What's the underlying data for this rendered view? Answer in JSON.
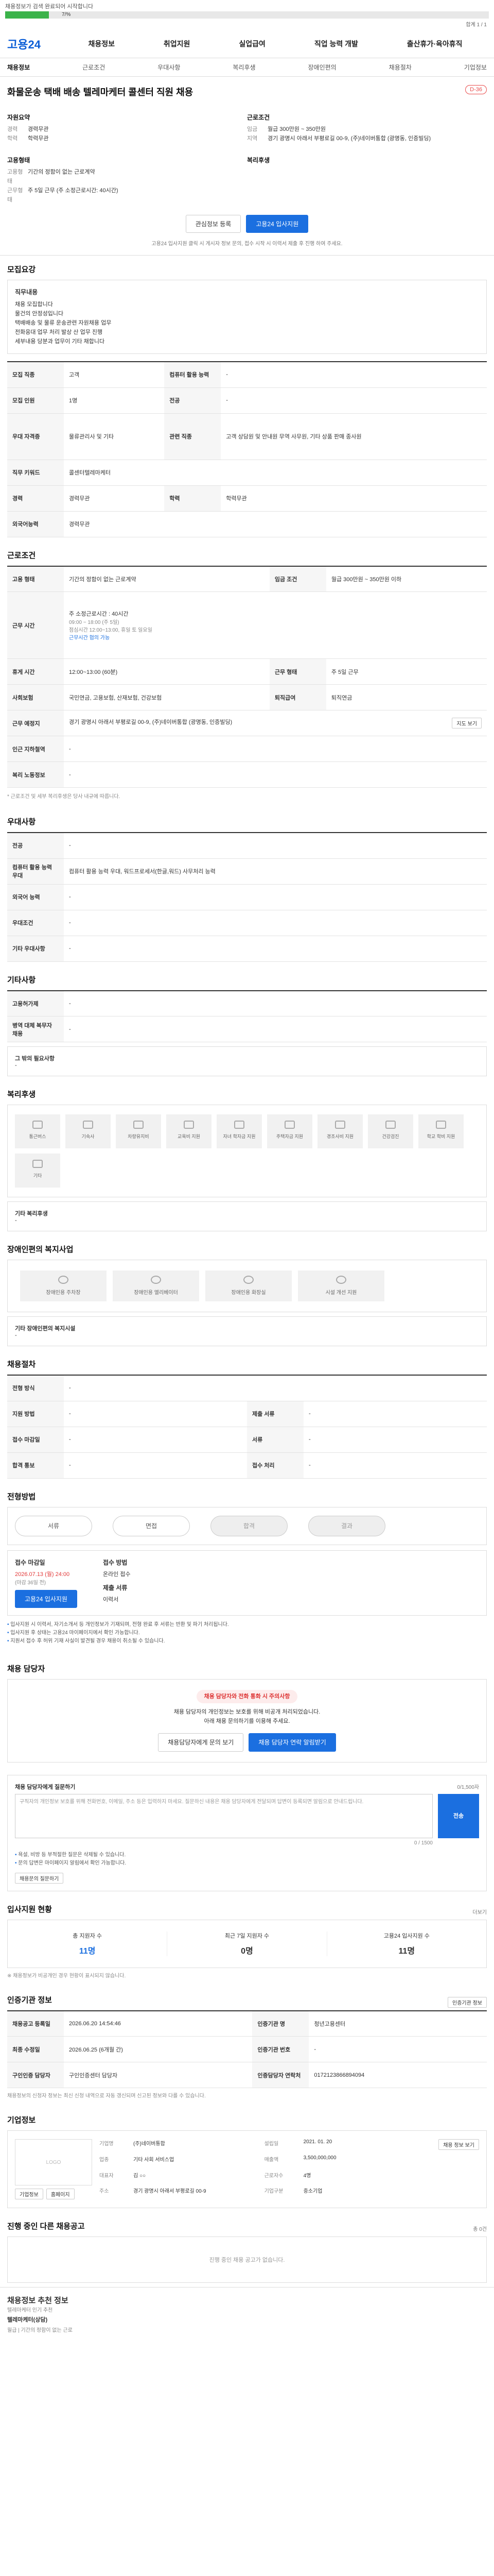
{
  "top": {
    "status": "채용정보가 검색 완료되어 시작합니다",
    "progress_label": "7/%",
    "progress": 0.09,
    "meta": "합계 1 / 1"
  },
  "header": {
    "logo": "고용24",
    "nav": [
      "채용정보",
      "취업지원",
      "실업급여",
      "직업 능력 개발",
      "출산휴가·육아휴직"
    ]
  },
  "subnav": [
    "채용정보",
    "근로조건",
    "우대사항",
    "복리후생",
    "장애인편의",
    "채용절차",
    "기업정보"
  ],
  "job": {
    "title": "화물운송 택배 배송 텔레마케터 콜센터 직원 채용",
    "dday": "D-36",
    "col1_h": "자원요약",
    "r1": [
      "경력",
      "경력무관"
    ],
    "r2": [
      "학력",
      "학력무관"
    ],
    "col2_h": "근로조건",
    "r3": [
      "임금",
      "월급 300만원 ~ 350만원"
    ],
    "r4": [
      "지역",
      "경기 광명시 아래서 부평로길 00-9, (주)네이버통합 (광명동, 인증빌딩)"
    ],
    "col3_h": "고용형태",
    "r5": [
      "고용형태",
      "기간의 정함이 없는 근로계약"
    ],
    "r6": [
      "근무형태",
      "주 5일 근무 (주 소정근로시간: 40시간)"
    ],
    "col4_h": "복리후생",
    "btn_save": "관심정보 등록",
    "btn_apply": "고용24 입사지원",
    "notice": "고용24 입사지원 클릭 시 게시자 정보 문의, 접수 시작 시 이력서 제출 후 진행 하여 주세요."
  },
  "sec_pref": {
    "title": "모집요강",
    "box_h": "직무내용",
    "box_lines": [
      "채용 모집합니다",
      "물건의 안정성입니다",
      "택배배송 및 물류 운송관련 자원채용 업무",
      "전화응대 업무 처리 발상 산 업무 진행",
      "세부내용 당분과 업무이 기타 채합니다"
    ],
    "rows": [
      [
        "모집 직종",
        "고객",
        "컴퓨터 활용 능력",
        "-"
      ],
      [
        "모집 인원",
        "1명",
        "전공",
        "-"
      ],
      [
        "우대 자격증",
        "물류관리사 및 기타",
        "관련 직종",
        "고객 상담원 및 안내원 무역 사무원, 기타 상품 판매 종사원"
      ],
      [
        "직무 키워드",
        "콜센터텔레마케터",
        "",
        ""
      ],
      [
        "경력",
        "경력무관",
        "학력",
        "학력무관"
      ],
      [
        "외국어능력",
        "경력무관",
        "",
        ""
      ]
    ]
  },
  "sec_cond": {
    "title": "근로조건",
    "rows": [
      [
        "고용 형태",
        "기간의 정함이 없는 근로계약",
        "임금 조건",
        "월급 300만원 ~ 350만원 이하"
      ],
      [
        "근무 시간",
        "주 소정근로시간 : 40시간",
        "",
        ""
      ],
      [
        "휴게 시간",
        "12:00~13:00 (60분)",
        "근무 형태",
        "주 5일 근무"
      ],
      [
        "사회보험",
        "국민연금, 고용보험, 산재보험, 건강보험",
        "퇴직급여",
        "퇴직연금"
      ],
      [
        "근무 예정지",
        "경기 광명시 아래서 부평로길 00-9, (주)네이버통합 (광명동, 인증빌딩)",
        "",
        ""
      ],
      [
        "인근 지하철역",
        "-",
        "",
        ""
      ],
      [
        "복리 노동정보",
        "-",
        "",
        ""
      ]
    ],
    "hours": [
      "09:00 ~ 18:00 (주 5일)",
      "점심시간 12:00~13:00, 휴일 토 일요일",
      "근무시간 협의 가능"
    ],
    "map_btn": "지도 보기",
    "note": "* 근로조건 및 세부 복리후생은 당사 내규에 따릅니다."
  },
  "sec_adv": {
    "title": "우대사항",
    "rows": [
      [
        "전공",
        "-"
      ],
      [
        "컴퓨터 활용 능력 우대",
        "컴퓨터 활용 능력 우대, 워드프로세서(한글,워드) 사무처리 능력"
      ],
      [
        "외국어 능력",
        "-"
      ],
      [
        "우대조건",
        "-"
      ],
      [
        "기타 우대사항",
        "-"
      ]
    ]
  },
  "sec_etc": {
    "title": "기타사항",
    "rows": [
      [
        "고용허가제",
        "-"
      ],
      [
        "병역 대체 복무자 채용",
        "-"
      ]
    ],
    "box": [
      "그 밖의 필요사항",
      "-"
    ]
  },
  "sec_welfare": {
    "title": "복리후생",
    "items": [
      "통근버스",
      "기숙사",
      "차량유지비",
      "교육비 지원",
      "자녀 학자금 지원",
      "주택자금 지원",
      "경조사비 지원",
      "건강검진",
      "학교 학비 지원",
      "기타"
    ],
    "list_h": "기타 복리후생",
    "list_v": "-"
  },
  "sec_disab": {
    "title": "장애인편의 복지사업",
    "items": [
      "장애인용 주차장",
      "장애인용 엘리베이터",
      "장애인용 화장실",
      "시설 개선 지원"
    ],
    "list_h": "기타 장애인편의 복지시설",
    "list_v": "-"
  },
  "sec_proc_info": {
    "title": "채용절차",
    "rows": [
      [
        "전형 방식",
        "-",
        "",
        ""
      ],
      [
        "지원 방법",
        "-",
        "제출 서류",
        "-"
      ],
      [
        "접수 마감일",
        "-",
        "서류",
        "-"
      ],
      [
        "합격 통보",
        "-",
        "접수 처리",
        "-"
      ]
    ]
  },
  "sec_proc": {
    "title": "전형방법",
    "steps": [
      "서류",
      "면접",
      "합격",
      "결과"
    ],
    "recv_h1": "접수 마감일",
    "recv_d1": "2026.07.13 (월) 24:00",
    "recv_sub1": "(마감 36일 전)",
    "recv_h2": "접수 방법",
    "recv_d2": "온라인 접수",
    "recv_h3": "제출 서류",
    "recv_d3": "이력서",
    "apply": "고용24 입사지원",
    "bullets": [
      "입사지원 시 이력서, 자기소개서 등 개인정보가 기재되며, 전형 완료 후 서류는 반환 및 파기 처리됩니다.",
      "입사지원 후 상태는 고용24 마이페이지에서 확인 가능합니다.",
      "지원서 접수 후 허위 기재 사실이 발견될 경우 채용이 취소될 수 있습니다."
    ]
  },
  "sec_contact": {
    "title": "채용 담당자",
    "pill": "채용 담당자와 전화 통화 시 주의사항",
    "lines": [
      "채용 담당자의 개인정보는 보호를 위해 비공개 처리되었습니다.",
      "아래 채용 문의하기를 이용해 주세요."
    ],
    "btn1": "채용담당자에게 문의 보기",
    "btn2": "채용 담당자 연락 알림받기"
  },
  "sec_qna": {
    "title": "채용 담당자에게 질문하기",
    "right": "0/1,500자",
    "placeholder": "구직자의 개인정보 보호를 위해 전화번호, 이메일, 주소 등은 입력하지 마세요. 질문하신 내용은 채용 담당자에게 전달되며 답변이 등록되면 알림으로 안내드립니다.",
    "send": "전송",
    "counter": "0 / 1500",
    "notes": [
      "욕설, 비방 등 부적절한 질문은 삭제될 수 있습니다.",
      "문의 답변은 마이페이지 알림에서 확인 가능합니다."
    ],
    "btn": "채용문의 질문하기"
  },
  "sec_stats": {
    "title": "입사지원 현황",
    "right": "더보기 ",
    "items": [
      [
        "총 지원자 수",
        "11명"
      ],
      [
        "최근 7일 지원자 수",
        "0명"
      ],
      [
        "고용24 입사지원 수",
        "11명"
      ]
    ],
    "note": "※ 채용정보가 비공개인 경우 현황이 표시되지 않습니다."
  },
  "sec_info": {
    "title": "인증기관 정보",
    "right": "인증기관 정보",
    "rows": [
      [
        "채용공고 등록일",
        "2026.06.20 14:54:46",
        "인증기관 명",
        "청년고용센터"
      ],
      [
        "최종 수정일",
        "2026.06.25 (6개월 간)",
        "인증기관 번호",
        "-"
      ],
      [
        "구인인증 담당자",
        "구인인증센터 담당자",
        "인증담당자 연락처",
        "0172123866894094"
      ]
    ],
    "note": "채용정보의 신청자 정보는 최신 신청 내역으로 자동 갱신되며 신고된 정보와 다를 수 있습니다."
  },
  "sec_company": {
    "title": "기업정보",
    "logo": "LOGO",
    "btn_home": "기업정보",
    "btn_more": "홈페이지",
    "fields": [
      [
        "기업명",
        "(주)네이버통합",
        "설립일",
        "2021. 01. 20"
      ],
      [
        "업종",
        "기타 사회 서비스업",
        "매출액",
        "3,500,000,000"
      ],
      [
        "대표자",
        "김 ○○",
        "근로자수",
        "4명"
      ],
      [
        "주소",
        "경기 광명시 아래서 부평로길 00-9",
        "기업구분",
        "중소기업"
      ]
    ],
    "btn_info": "채용 정보 보기"
  },
  "sec_jobs": {
    "title": "진행 중인 다른 채용공고",
    "empty": "진행 중인 채용 공고가 없습니다.",
    "right": "총 0건"
  },
  "sec_rec": {
    "title": "채용정보 추천 정보",
    "sub": "텔레마케터 인기 추천",
    "name": "텔레마케터(상담)",
    "meta": "월급 | 기간의 정함이 없는 근로"
  }
}
